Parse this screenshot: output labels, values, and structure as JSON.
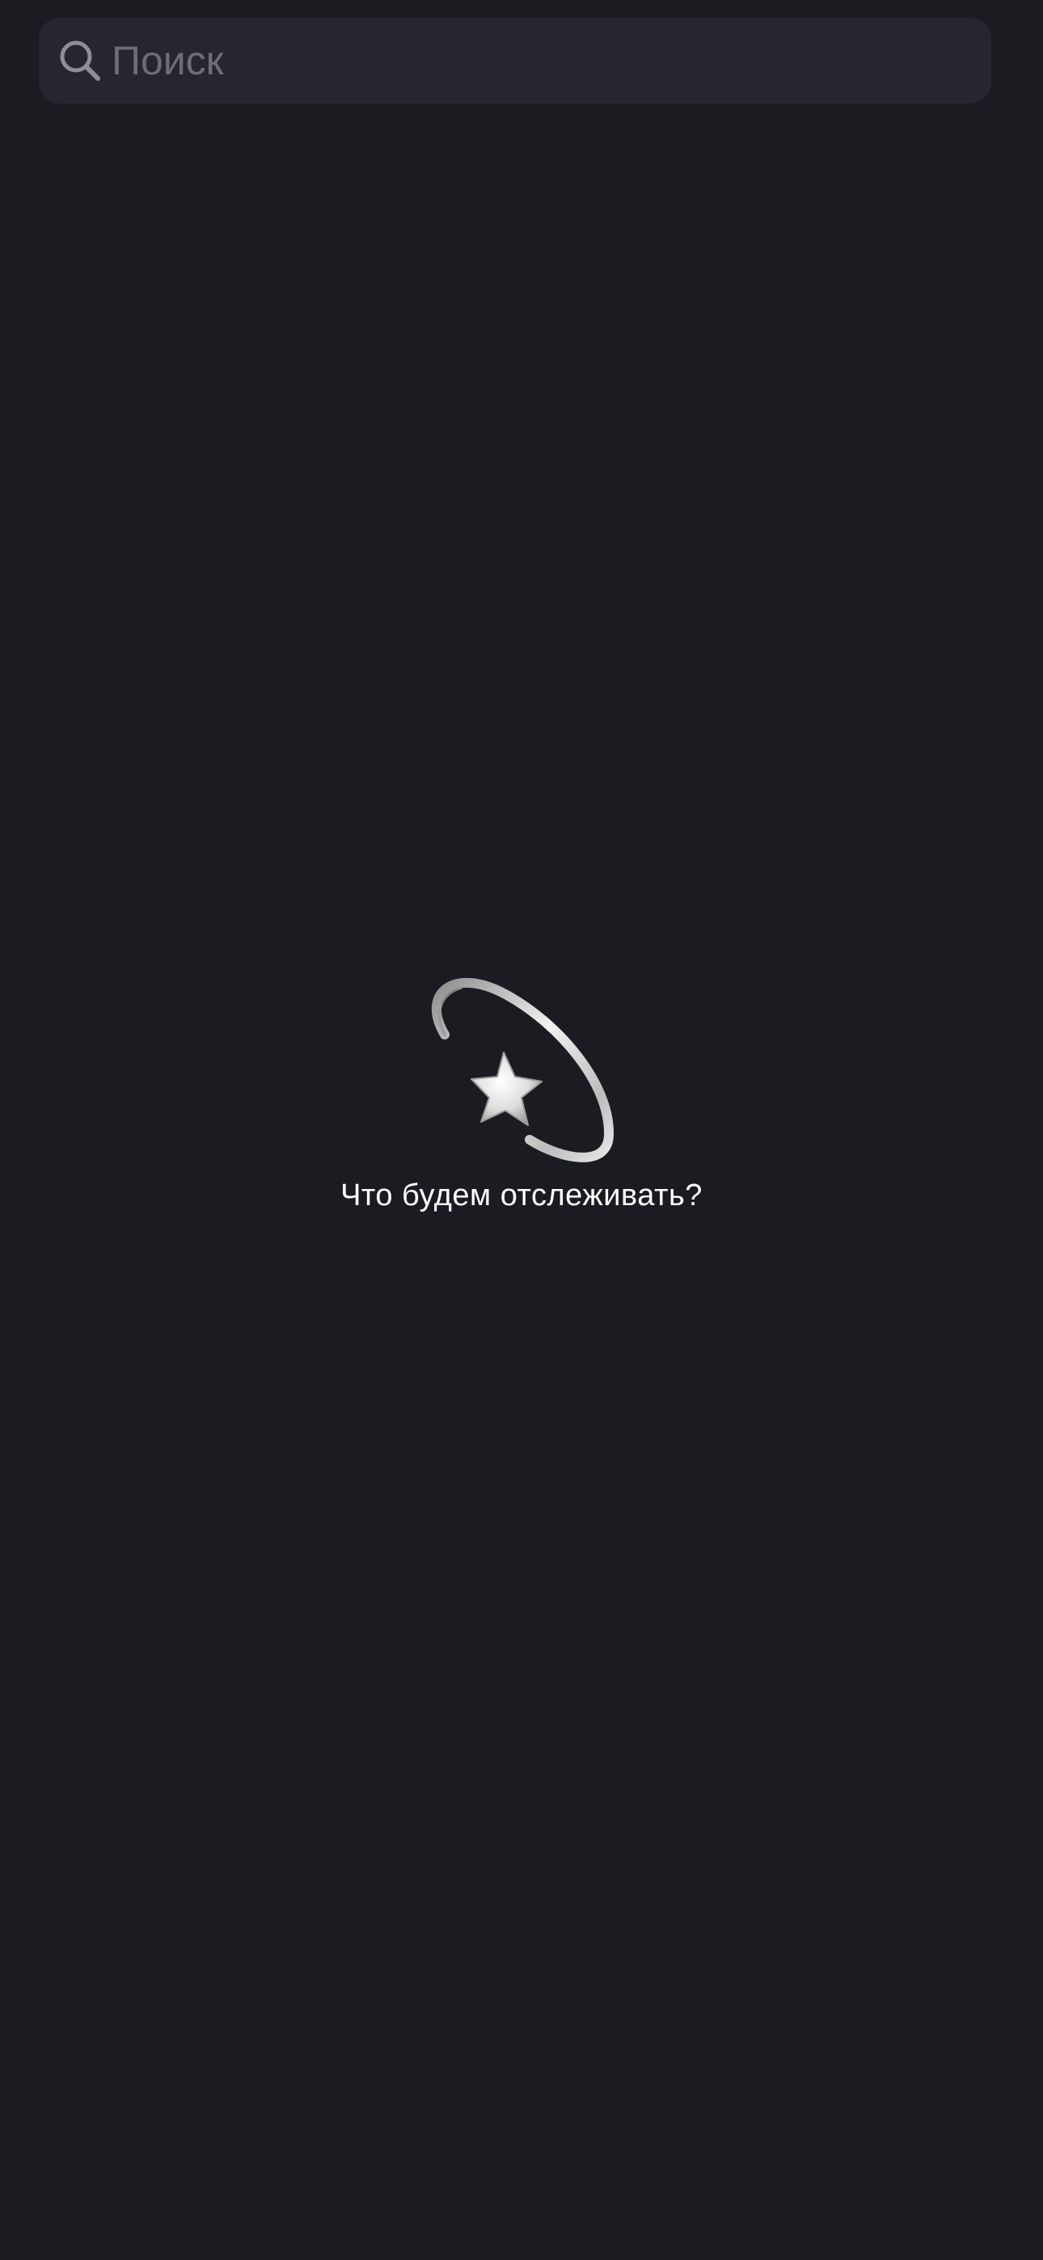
{
  "search": {
    "placeholder": "Поиск",
    "value": "",
    "icon": "search-icon"
  },
  "empty_state": {
    "icon": "dizzy-star-icon",
    "message": "Что будем отслеживать?"
  },
  "colors": {
    "background": "#1b1b22",
    "search_field": "#26262f",
    "placeholder": "#6d6d78",
    "text": "#ffffff"
  }
}
